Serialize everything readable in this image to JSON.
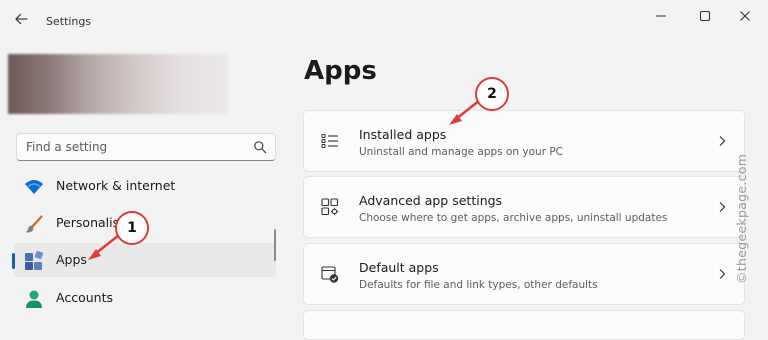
{
  "window": {
    "title": "Settings"
  },
  "search": {
    "placeholder": "Find a setting"
  },
  "sidebar": {
    "items": [
      {
        "label": "Network & internet",
        "icon": "wifi-icon",
        "color": "#0a6fd1"
      },
      {
        "label": "Personalis",
        "icon": "paintbrush-icon",
        "color": "#c4702c"
      },
      {
        "label": "Apps",
        "icon": "apps-icon",
        "color": "#3a5a9a",
        "selected": true
      },
      {
        "label": "Accounts",
        "icon": "person-icon",
        "color": "#1fa67a"
      }
    ]
  },
  "main": {
    "title": "Apps",
    "cards": [
      {
        "title": "Installed apps",
        "subtitle": "Uninstall and manage apps on your PC",
        "icon": "list-icon"
      },
      {
        "title": "Advanced app settings",
        "subtitle": "Choose where to get apps, archive apps, uninstall updates",
        "icon": "app-settings-icon"
      },
      {
        "title": "Default apps",
        "subtitle": "Defaults for file and link types, other defaults",
        "icon": "default-apps-icon"
      }
    ]
  },
  "annotations": [
    {
      "label": "1",
      "color": "#e03b3b"
    },
    {
      "label": "2",
      "color": "#e03b3b"
    }
  ],
  "watermark": "©thegeekpage.com",
  "colors": {
    "accent": "#1a5fb4",
    "annotation": "#e03b3b",
    "background": "#f3f3f3"
  }
}
